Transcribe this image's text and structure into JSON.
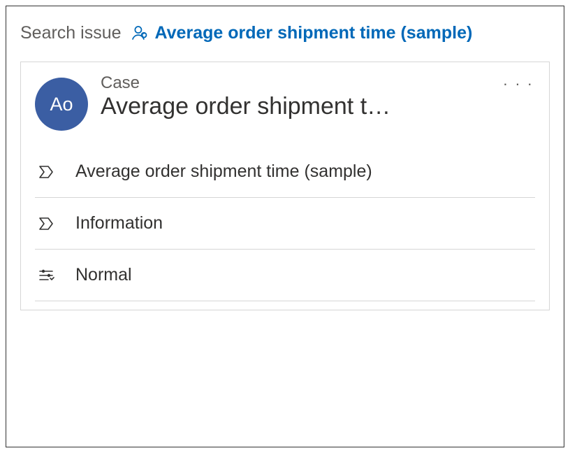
{
  "breadcrumb": {
    "root": "Search issue",
    "current": "Average order shipment time (sample)"
  },
  "card": {
    "avatar_initials": "Ao",
    "entity_type": "Case",
    "title": "Average order shipment t…",
    "details": [
      {
        "label": "Average order shipment time (sample)"
      },
      {
        "label": "Information"
      },
      {
        "label": "Normal"
      }
    ]
  }
}
